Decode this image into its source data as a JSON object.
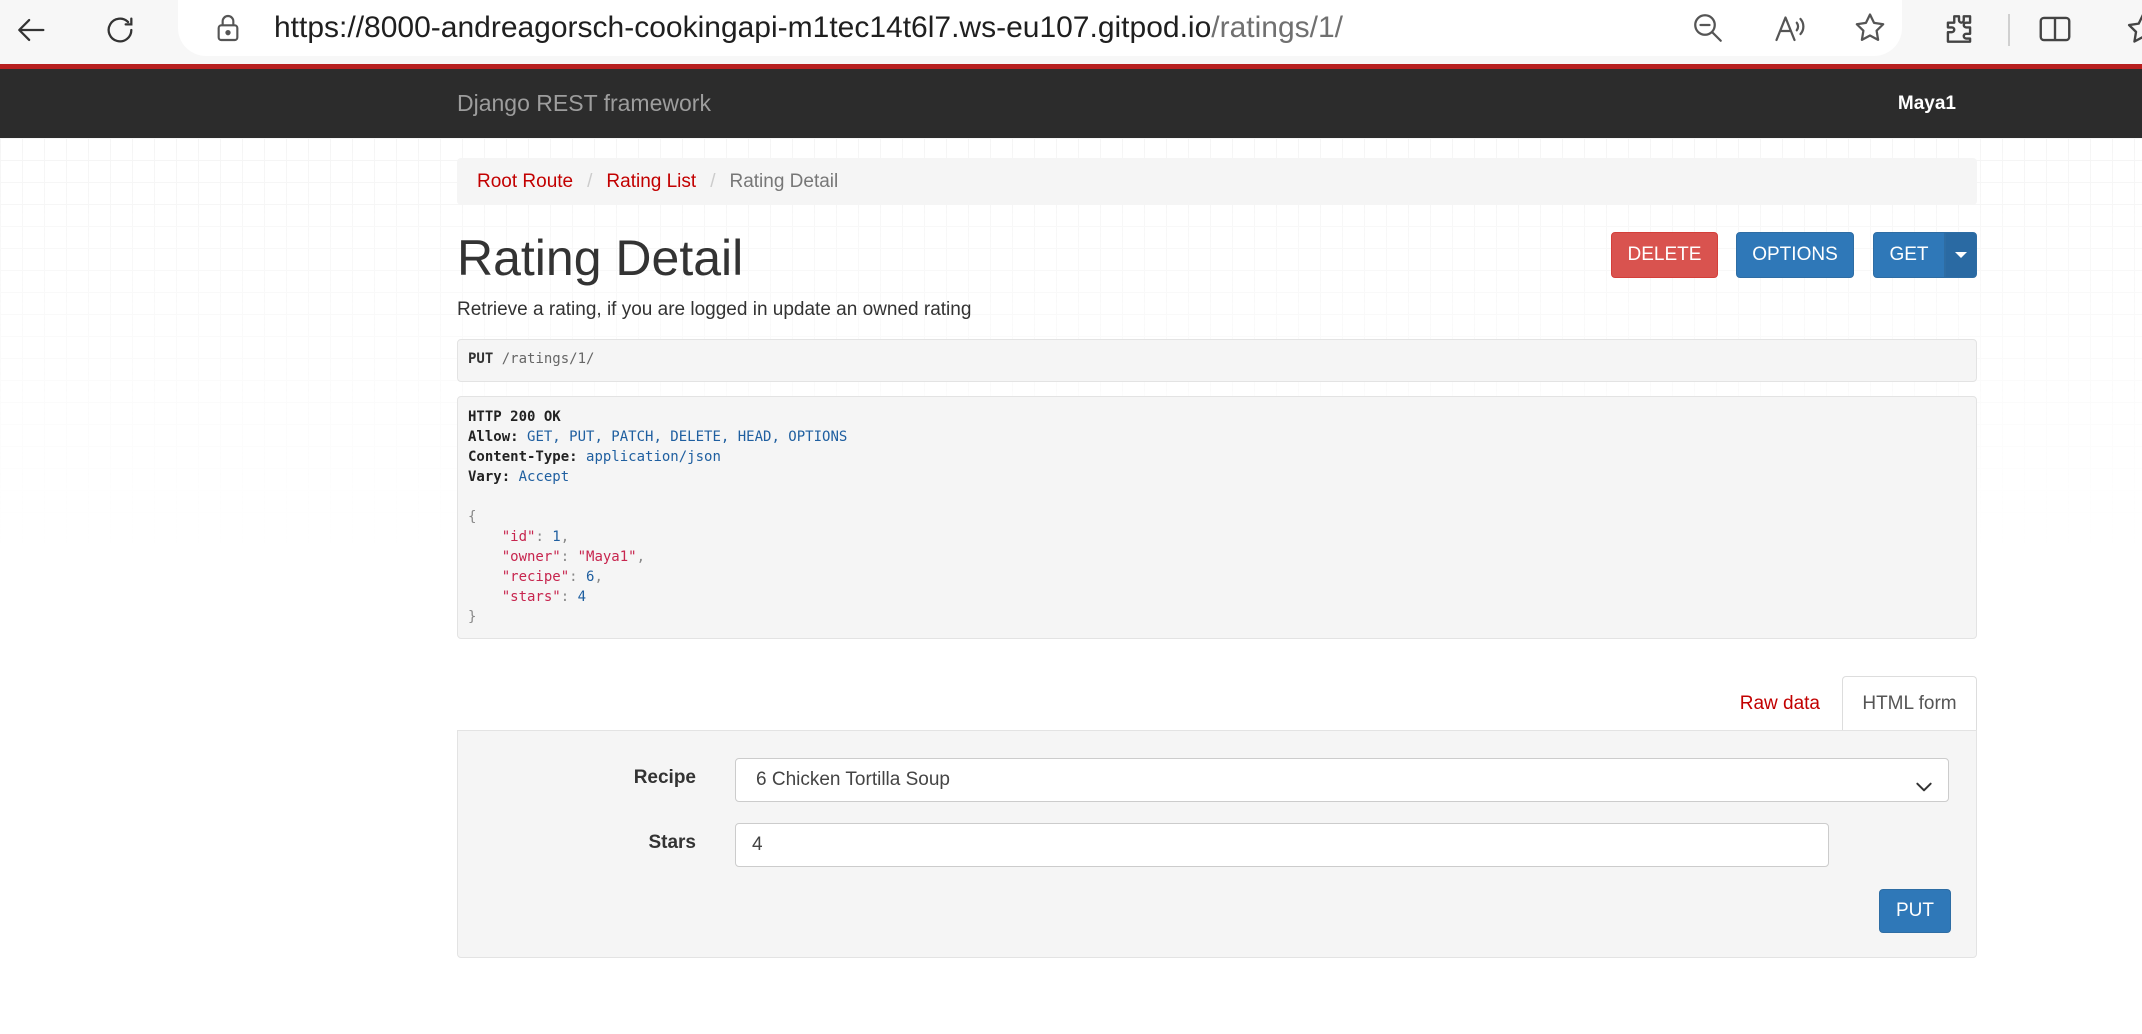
{
  "browser": {
    "url_host": "https://8000-andreagorsch-cookingapi-m1tec14t6l7.ws-eu107.gitpod.io",
    "url_path": "/ratings/1/"
  },
  "navbar": {
    "brand": "Django REST framework",
    "user": "Maya1"
  },
  "breadcrumb": {
    "items": [
      "Root Route",
      "Rating List",
      "Rating Detail"
    ]
  },
  "page": {
    "title": "Rating Detail",
    "description": "Retrieve a rating, if you are logged in update an owned rating"
  },
  "actions": {
    "delete_label": "DELETE",
    "options_label": "OPTIONS",
    "get_label": "GET"
  },
  "request": {
    "method": "PUT",
    "path": "/ratings/1/"
  },
  "response": {
    "status": "HTTP 200 OK",
    "headers": [
      {
        "key": "Allow:",
        "value": "GET, PUT, PATCH, DELETE, HEAD, OPTIONS"
      },
      {
        "key": "Content-Type:",
        "value": "application/json"
      },
      {
        "key": "Vary:",
        "value": "Accept"
      }
    ],
    "body": [
      {
        "key": "\"id\"",
        "value": "1",
        "type": "num",
        "comma": true
      },
      {
        "key": "\"owner\"",
        "value": "\"Maya1\"",
        "type": "str",
        "comma": true
      },
      {
        "key": "\"recipe\"",
        "value": "6",
        "type": "num",
        "comma": true
      },
      {
        "key": "\"stars\"",
        "value": "4",
        "type": "num",
        "comma": false
      }
    ]
  },
  "tabs": {
    "raw": "Raw data",
    "html": "HTML form"
  },
  "form": {
    "recipe_label": "Recipe",
    "recipe_value": "6 Chicken Tortilla Soup",
    "stars_label": "Stars",
    "stars_value": "4",
    "submit_label": "PUT"
  },
  "colors": {
    "accent": "#b81f1f",
    "link": "#c20000",
    "primary": "#2f78b8",
    "danger": "#d9534f",
    "navbar": "#2c2c2c"
  }
}
